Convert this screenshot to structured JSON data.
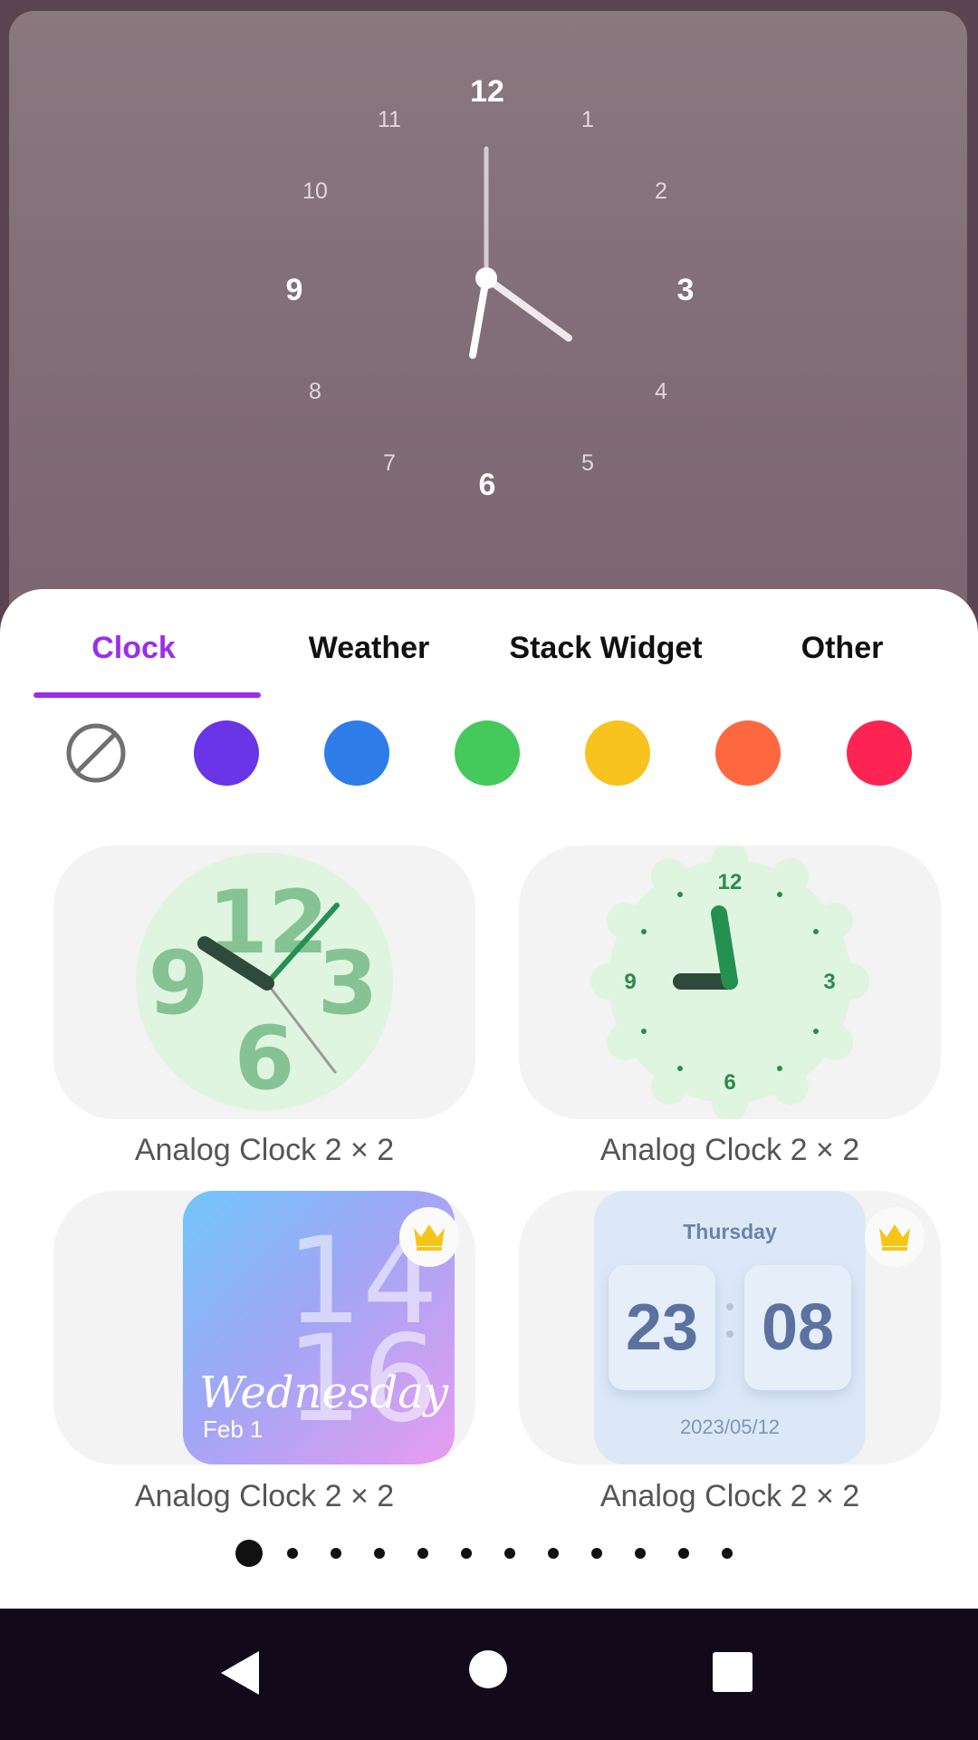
{
  "preview_clock": {
    "numbers": [
      "12",
      "1",
      "2",
      "3",
      "4",
      "5",
      "6",
      "7",
      "8",
      "9",
      "10",
      "11"
    ]
  },
  "tabs": [
    {
      "label": "Clock",
      "active": true
    },
    {
      "label": "Weather",
      "active": false
    },
    {
      "label": "Stack Widget",
      "active": false
    },
    {
      "label": "Other",
      "active": false
    }
  ],
  "colors": {
    "accent": "#9b2fe8",
    "swatches": [
      "none",
      "#6a35e6",
      "#2e7de8",
      "#45c95a",
      "#f8c21f",
      "#fe6840",
      "#fd2453"
    ]
  },
  "widgets": [
    {
      "label": "Analog Clock  2 × 2",
      "premium": false,
      "style": "green-bold-numbers"
    },
    {
      "label": "Analog Clock  2 × 2",
      "premium": false,
      "style": "green-scalloped",
      "numbers": [
        "12",
        "3",
        "6",
        "9"
      ]
    },
    {
      "label": "Analog Clock  2 × 2",
      "premium": true,
      "style": "gradient",
      "hour": "14",
      "minute": "16",
      "day": "Wednesday",
      "date": "Feb 1"
    },
    {
      "label": "Analog Clock  2 × 2",
      "premium": true,
      "style": "flip",
      "day": "Thursday",
      "hour": "23",
      "minute": "08",
      "date": "2023/05/12"
    }
  ],
  "pagination": {
    "total": 12,
    "current": 1
  },
  "nav": {
    "back": "back-icon",
    "home": "home-icon",
    "recents": "recents-icon"
  }
}
